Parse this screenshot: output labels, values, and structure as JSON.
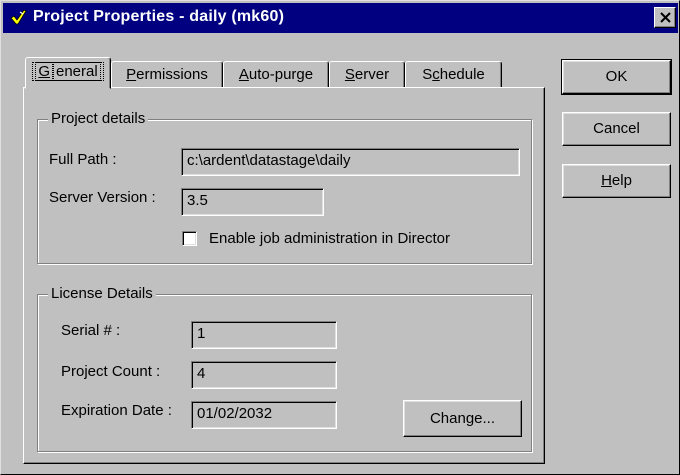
{
  "window": {
    "title": "Project Properties - daily (mk60)"
  },
  "tabs": [
    {
      "label": "General",
      "accel": "G",
      "rest": "eneral",
      "active": true
    },
    {
      "label": "Permissions",
      "accel": "P",
      "rest": "ermissions",
      "active": false
    },
    {
      "label": "Auto-purge",
      "accel": "A",
      "rest": "uto-purge",
      "active": false
    },
    {
      "label": "Server",
      "accel": "S",
      "rest": "erver",
      "active": false
    },
    {
      "label": "Schedule",
      "pre": "S",
      "accel": "c",
      "rest": "hedule",
      "active": false
    }
  ],
  "project_details": {
    "group_label": "Project details",
    "full_path_label": "Full Path :",
    "full_path_value": "c:\\ardent\\datastage\\daily",
    "server_version_label": "Server Version :",
    "server_version_value": "3.5",
    "enable_job_admin_label": "Enable job administration in Director",
    "enable_job_admin_checked": false
  },
  "license_details": {
    "group_label": "License Details",
    "serial_label": "Serial # :",
    "serial_value": "1",
    "project_count_label": "Project Count :",
    "project_count_value": "4",
    "expiration_label": "Expiration Date :",
    "expiration_value": "01/02/2032",
    "change_pre": "Chan",
    "change_accel": "g",
    "change_rest": "e..."
  },
  "buttons": {
    "ok": "OK",
    "cancel": "Cancel",
    "help_accel": "H",
    "help_rest": "elp"
  }
}
